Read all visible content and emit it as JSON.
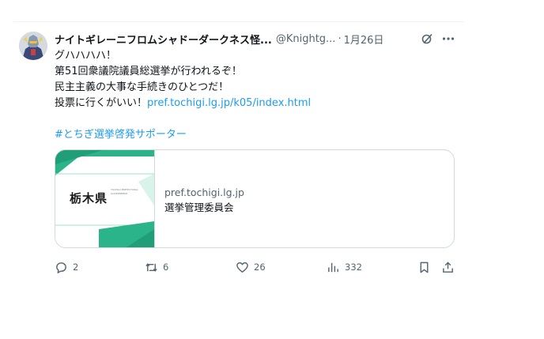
{
  "tweet": {
    "display_name": "ナイトギレーニフロムシャドーダークネス怪...",
    "handle": "@Knightg...",
    "separator": "·",
    "date": "1月26日",
    "lines": [
      "グハハハハ！",
      "第51回衆議院議員総選挙が行われるぞ！",
      "民主主義の大事な手続きのひとつだ！"
    ],
    "last_line_prefix": "投票に行くがいい！",
    "link": "pref.tochigi.lg.jp/k05/index.html",
    "hashtag": "#とちぎ選挙啓発サポーター"
  },
  "card": {
    "thumb_label": "栃木県",
    "thumb_sublabel": "TOCHIGI PREFECTURAL GOVERNMENT",
    "domain": "pref.tochigi.lg.jp",
    "title": "選挙管理委員会"
  },
  "actions": {
    "replies": "2",
    "reposts": "6",
    "likes": "26",
    "views": "332"
  },
  "icons": {
    "reply": "reply-icon",
    "repost": "repost-icon",
    "like": "heart-icon",
    "views": "views-icon",
    "bookmark": "bookmark-icon",
    "share": "share-icon",
    "grok": "grok-icon",
    "more": "more-icon"
  },
  "colors": {
    "link": "#1d9bf0",
    "secondary_text": "#536471",
    "primary_text": "#0f1419",
    "thumb_green": "#2bb38a"
  }
}
